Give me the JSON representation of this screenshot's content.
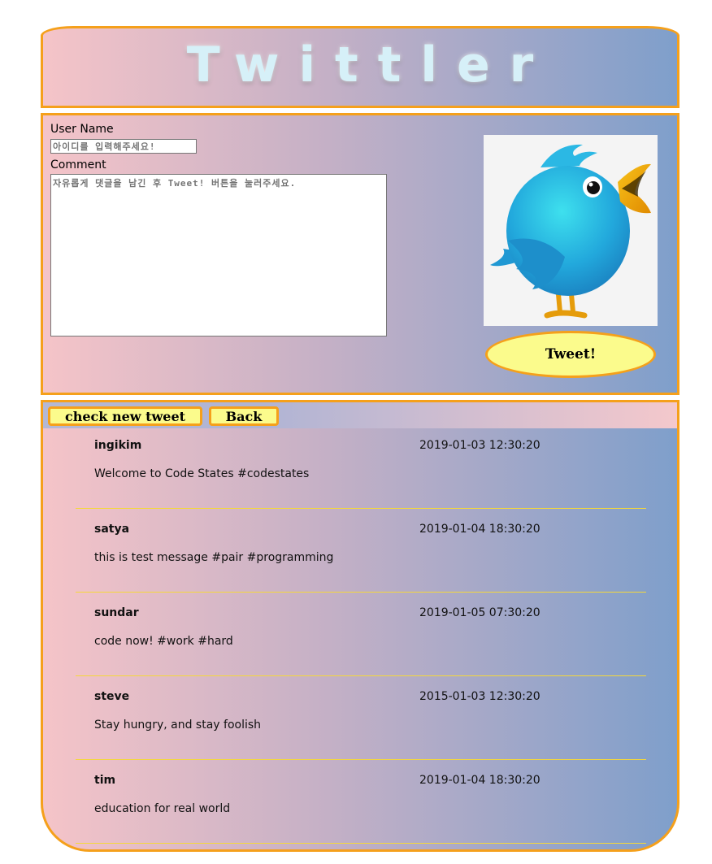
{
  "header": {
    "title": "Twittler"
  },
  "compose": {
    "username_label": "User Name",
    "username_placeholder": "아이디를 입력해주세요!",
    "comment_label": "Comment",
    "comment_placeholder": "자유롭게 댓글을 남긴 후 Tweet! 버튼을 눌러주세요.",
    "tweet_button": "Tweet!",
    "bird_icon": "twitter-bird-icon"
  },
  "toolbar": {
    "check_label": "check new tweet",
    "back_label": "Back"
  },
  "tweets": [
    {
      "user": "ingikim",
      "created_at": "2019-01-03 12:30:20",
      "message": "Welcome to Code States #codestates"
    },
    {
      "user": "satya",
      "created_at": "2019-01-04 18:30:20",
      "message": "this is test message #pair #programming"
    },
    {
      "user": "sundar",
      "created_at": "2019-01-05 07:30:20",
      "message": "code now! #work #hard"
    },
    {
      "user": "steve",
      "created_at": "2015-01-03 12:30:20",
      "message": "Stay hungry, and stay foolish"
    },
    {
      "user": "tim",
      "created_at": "2019-01-04 18:30:20",
      "message": "education for real world"
    }
  ],
  "colors": {
    "accent": "#f5a01b",
    "button_bg": "#fbfb8c",
    "divider": "#f5d83a"
  }
}
